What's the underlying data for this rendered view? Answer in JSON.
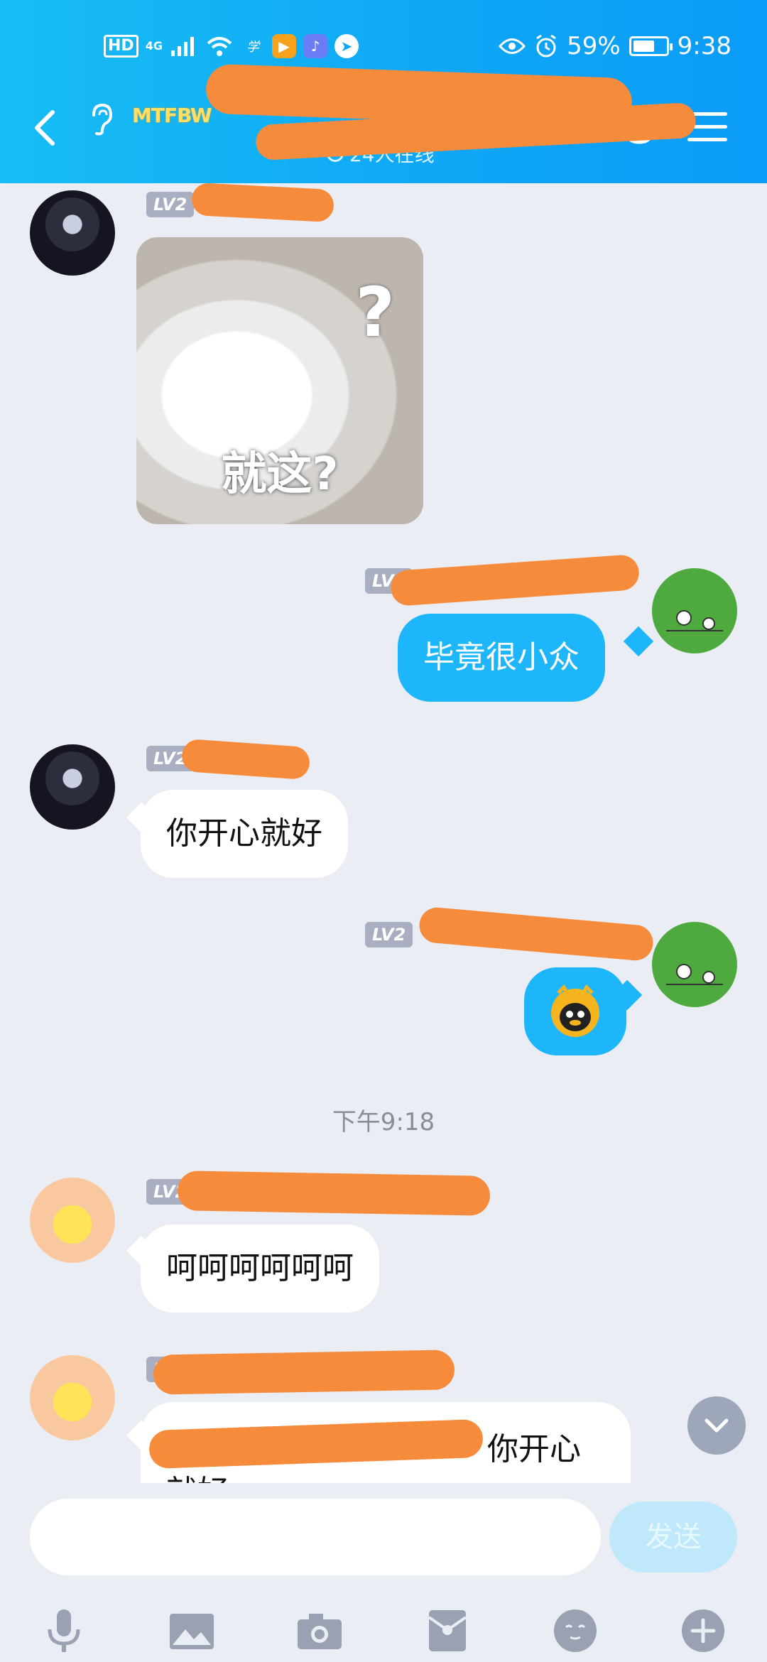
{
  "status_bar": {
    "network_hd": "HD",
    "network_4g": "4G",
    "battery": "59%",
    "battery_level": 0.59,
    "time": "9:38"
  },
  "header": {
    "group_tag": "MTFBW",
    "online_text": "24人在线"
  },
  "messages": [
    {
      "level": "LV2",
      "type": "sticker",
      "question_mark": "?",
      "caption": "就这?"
    },
    {
      "level": "LV2",
      "type": "text",
      "text": "毕竟很小众"
    },
    {
      "level": "LV2",
      "type": "text",
      "text": "你开心就好"
    },
    {
      "level": "LV2",
      "type": "emoji"
    },
    {
      "level": "LV2",
      "type": "text",
      "text": "呵呵呵呵呵呵"
    },
    {
      "level": "LV2",
      "type": "text",
      "text": "你开心",
      "text_line2": "就好"
    }
  ],
  "time_separator": "下午9:18",
  "composer": {
    "placeholder": "",
    "send_label": "发送"
  },
  "colors": {
    "header": "#0fa6f6",
    "outgoing_bubble": "#1eb6fb",
    "incoming_bubble": "#ffffff",
    "background": "#eaedf3",
    "redaction": "#f78b3c"
  }
}
